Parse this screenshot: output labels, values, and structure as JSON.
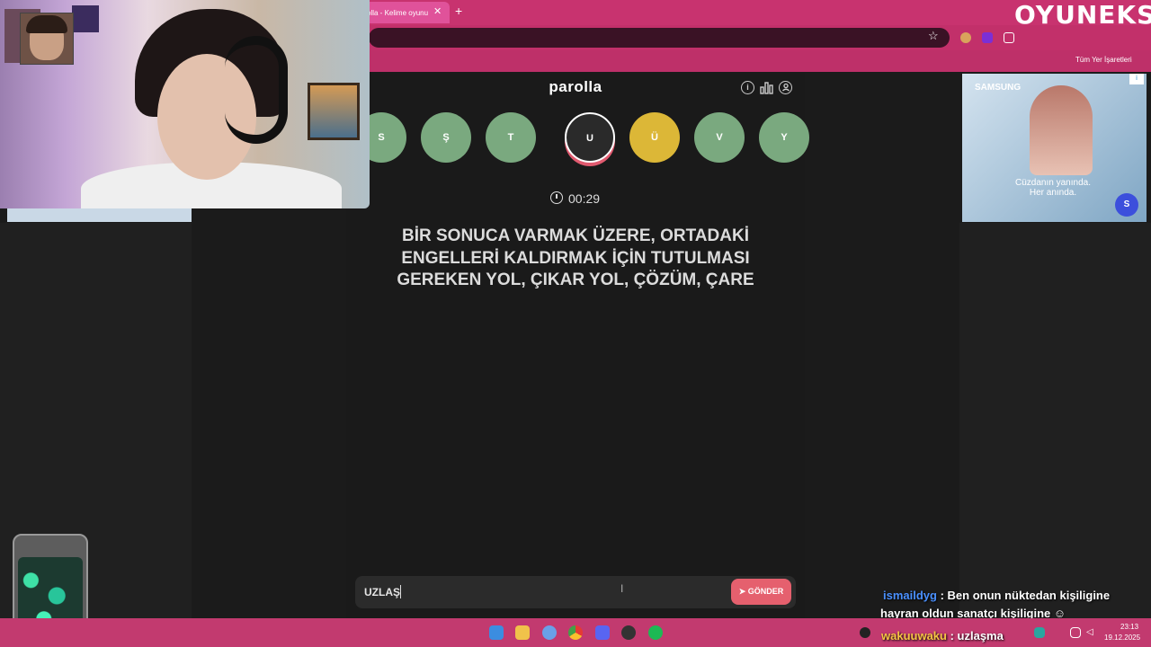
{
  "browser": {
    "tab_title": "olla - Kelime oyunu",
    "tab_close": "✕",
    "new_tab": "+",
    "bookmarks_label": "Tüm Yer İşaretleri",
    "star": "☆"
  },
  "overlay": {
    "logo": "OYUNEKS",
    "chat": [
      {
        "user": "ismaildyg",
        "sep": " : ",
        "text": "Ben onun nüktedan kişiligine"
      },
      {
        "user": "",
        "sep": "",
        "text": "hayran oldun sanatçı kişiligine"
      },
      {
        "user": "wakuuwaku",
        "sep": " : ",
        "text": "uzlaşma"
      }
    ]
  },
  "ad": {
    "brand": "SAMSUNG",
    "tagline": "Cüzdanın yanında. Her anında.",
    "wallet": "S"
  },
  "game": {
    "title": "parolla",
    "letters": [
      {
        "char": "S",
        "state": "correct"
      },
      {
        "char": "Ş",
        "state": "correct"
      },
      {
        "char": "T",
        "state": "correct"
      },
      {
        "char": "U",
        "state": "active"
      },
      {
        "char": "Ü",
        "state": "passed"
      },
      {
        "char": "V",
        "state": "correct"
      },
      {
        "char": "Y",
        "state": "correct"
      }
    ],
    "timer": "00:29",
    "question": "BİR SONUCA VARMAK ÜZERE, ORTADAKİ ENGELLERİ KALDIRMAK İÇİN TUTULMASI GEREKEN YOL, ÇIKAR YOL, ÇÖZÜM, ÇARE",
    "answer_value": "UZLAŞ",
    "send_label": "GÖNDER",
    "info_icon": "i",
    "stats_icon": "▮",
    "profile_icon": "◉"
  },
  "colors": {
    "correct": "#7aa97f",
    "passed": "#dcb737",
    "accent": "#e5606e"
  },
  "taskbar": {
    "time": "23:13",
    "date": "19.12.2025"
  }
}
